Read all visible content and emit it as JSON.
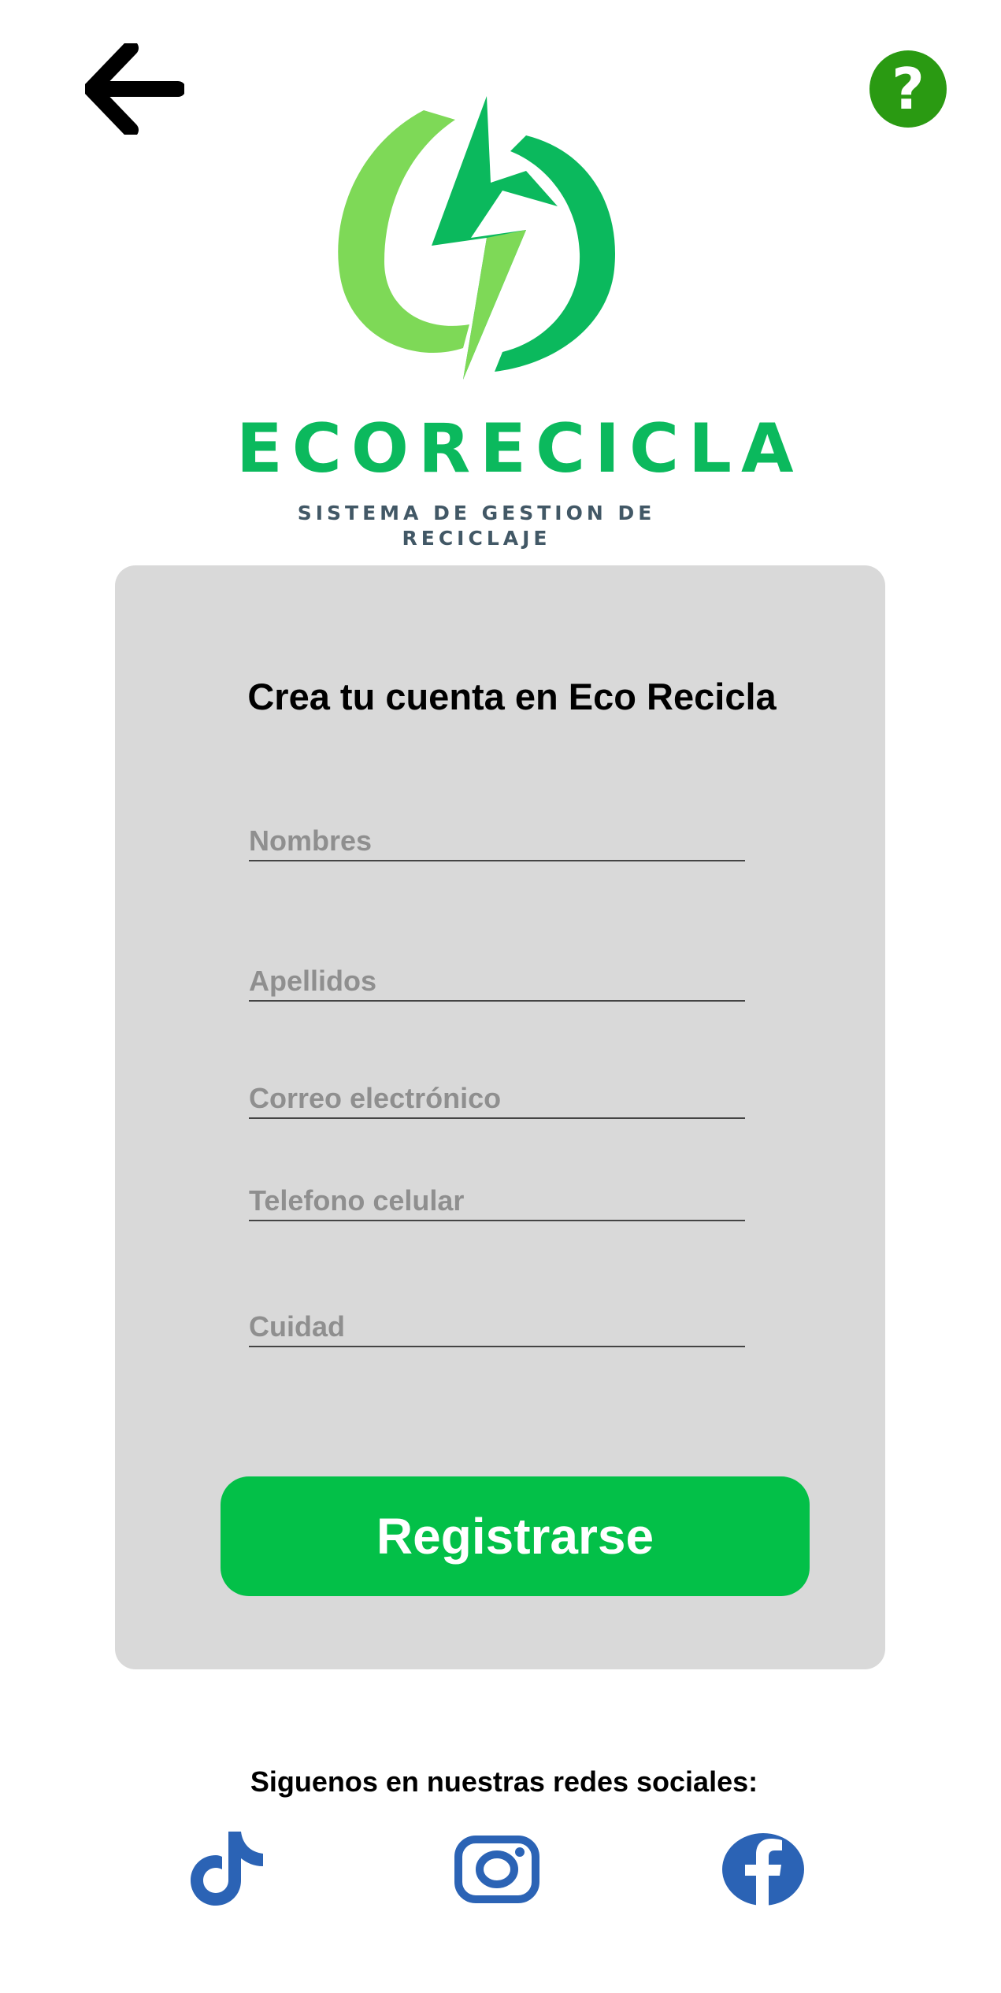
{
  "header": {
    "back_icon": "arrow-left-icon",
    "help_icon": "question-mark-icon",
    "help_glyph": "?",
    "help_color": "#2a9a12"
  },
  "brand": {
    "name": "ECORECICLA",
    "tagline": "SISTEMA DE GESTION DE RECICLAJE",
    "primary_color": "#0bb95d",
    "secondary_color": "#7ed957"
  },
  "form": {
    "title": "Crea tu cuenta en Eco Recicla",
    "fields": [
      {
        "placeholder": "Nombres"
      },
      {
        "placeholder": "Apellidos"
      },
      {
        "placeholder": "Correo electrónico"
      },
      {
        "placeholder": "Telefono celular"
      },
      {
        "placeholder": "Cuidad"
      }
    ],
    "submit_label": "Registrarse",
    "submit_color": "#03c048",
    "card_color": "#d9d9d9"
  },
  "social": {
    "label": "Siguenos en nuestras redes sociales:",
    "icons": [
      "tiktok-icon",
      "instagram-icon",
      "facebook-icon"
    ],
    "icon_color": "#2b63b5"
  }
}
